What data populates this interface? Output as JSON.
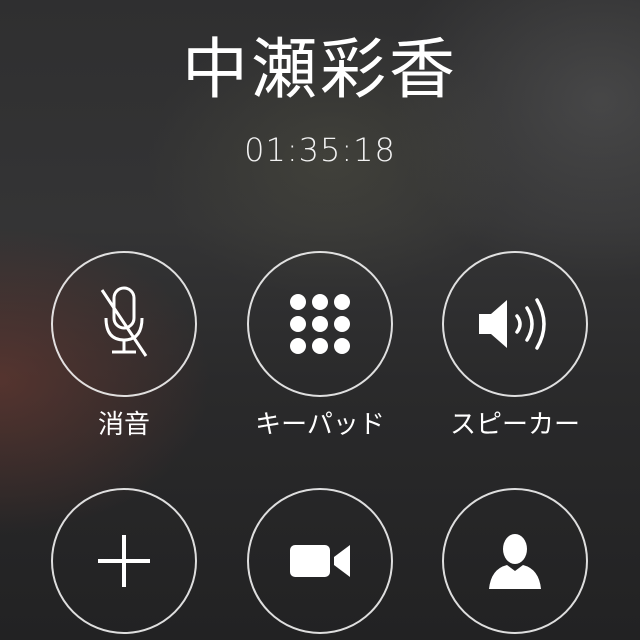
{
  "call": {
    "caller_name": "中瀬彩香",
    "duration": "01:35:18"
  },
  "buttons": [
    {
      "id": "mute",
      "label": "消音",
      "icon": "microphone-muted-icon"
    },
    {
      "id": "keypad",
      "label": "キーパッド",
      "icon": "keypad-grid-icon"
    },
    {
      "id": "speaker",
      "label": "スピーカー",
      "icon": "speaker-icon"
    },
    {
      "id": "add-call",
      "label": "",
      "icon": "plus-icon"
    },
    {
      "id": "facetime",
      "label": "",
      "icon": "video-camera-icon"
    },
    {
      "id": "contacts",
      "label": "",
      "icon": "contact-person-icon"
    }
  ],
  "colors": {
    "text": "#ffffff",
    "button_border": "#ffffff"
  }
}
